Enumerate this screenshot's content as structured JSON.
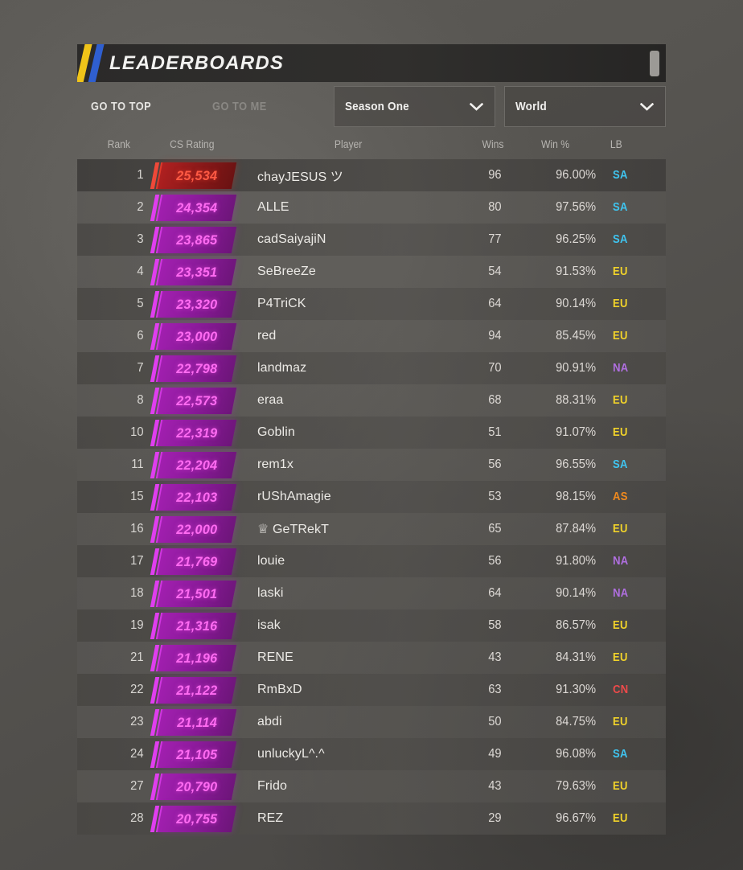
{
  "header": {
    "title": "LEADERBOARDS"
  },
  "toolbar": {
    "go_to_top": "GO TO TOP",
    "go_to_me": "GO TO ME",
    "season_dropdown": {
      "value": "Season One",
      "icon": "chevron-down-icon"
    },
    "region_dropdown": {
      "value": "World",
      "icon": "chevron-down-icon"
    }
  },
  "columns": {
    "rank": "Rank",
    "rating": "CS Rating",
    "player": "Player",
    "wins": "Wins",
    "win_pct": "Win %",
    "lb": "LB"
  },
  "region_colors": {
    "SA": "#3fc4ef",
    "EU": "#f0d22a",
    "NA": "#b06fe0",
    "AS": "#f08a1e",
    "CN": "#ef4a4a"
  },
  "accents": {
    "yellow_bar": "#f0c419",
    "blue_bar": "#2f5fd0",
    "badge_magenta": "#a21fb0",
    "badge_magenta_text": "#ff6bf2",
    "badge_red": "#b02020",
    "badge_red_text": "#ff5a44"
  },
  "rows": [
    {
      "rank": "1",
      "rating": "25,534",
      "player": "chayJESUS ツ",
      "wins": "96",
      "win_pct": "96.00%",
      "lb": "SA",
      "top": true
    },
    {
      "rank": "2",
      "rating": "24,354",
      "player": "ALLE",
      "wins": "80",
      "win_pct": "97.56%",
      "lb": "SA"
    },
    {
      "rank": "3",
      "rating": "23,865",
      "player": "cadSaiyajiN",
      "wins": "77",
      "win_pct": "96.25%",
      "lb": "SA"
    },
    {
      "rank": "4",
      "rating": "23,351",
      "player": "SeBreeZe",
      "wins": "54",
      "win_pct": "91.53%",
      "lb": "EU"
    },
    {
      "rank": "5",
      "rating": "23,320",
      "player": "P4TriCK",
      "wins": "64",
      "win_pct": "90.14%",
      "lb": "EU"
    },
    {
      "rank": "6",
      "rating": "23,000",
      "player": "red",
      "wins": "94",
      "win_pct": "85.45%",
      "lb": "EU"
    },
    {
      "rank": "7",
      "rating": "22,798",
      "player": "landmaz",
      "wins": "70",
      "win_pct": "90.91%",
      "lb": "NA"
    },
    {
      "rank": "8",
      "rating": "22,573",
      "player": "eraa",
      "wins": "68",
      "win_pct": "88.31%",
      "lb": "EU"
    },
    {
      "rank": "10",
      "rating": "22,319",
      "player": "Goblin",
      "wins": "51",
      "win_pct": "91.07%",
      "lb": "EU"
    },
    {
      "rank": "11",
      "rating": "22,204",
      "player": "rem1x",
      "wins": "56",
      "win_pct": "96.55%",
      "lb": "SA"
    },
    {
      "rank": "15",
      "rating": "22,103",
      "player": "rUShAmagie",
      "wins": "53",
      "win_pct": "98.15%",
      "lb": "AS"
    },
    {
      "rank": "16",
      "rating": "22,000",
      "player": "♕ GeTRekT",
      "wins": "65",
      "win_pct": "87.84%",
      "lb": "EU"
    },
    {
      "rank": "17",
      "rating": "21,769",
      "player": "louie",
      "wins": "56",
      "win_pct": "91.80%",
      "lb": "NA"
    },
    {
      "rank": "18",
      "rating": "21,501",
      "player": "laski",
      "wins": "64",
      "win_pct": "90.14%",
      "lb": "NA"
    },
    {
      "rank": "19",
      "rating": "21,316",
      "player": "isak",
      "wins": "58",
      "win_pct": "86.57%",
      "lb": "EU"
    },
    {
      "rank": "21",
      "rating": "21,196",
      "player": "RENE",
      "wins": "43",
      "win_pct": "84.31%",
      "lb": "EU"
    },
    {
      "rank": "22",
      "rating": "21,122",
      "player": "RmBxD",
      "wins": "63",
      "win_pct": "91.30%",
      "lb": "CN"
    },
    {
      "rank": "23",
      "rating": "21,114",
      "player": "abdi",
      "wins": "50",
      "win_pct": "84.75%",
      "lb": "EU"
    },
    {
      "rank": "24",
      "rating": "21,105",
      "player": "unluckyL^.^",
      "wins": "49",
      "win_pct": "96.08%",
      "lb": "SA"
    },
    {
      "rank": "27",
      "rating": "20,790",
      "player": "Frido",
      "wins": "43",
      "win_pct": "79.63%",
      "lb": "EU"
    },
    {
      "rank": "28",
      "rating": "20,755",
      "player": "REZ",
      "wins": "29",
      "win_pct": "96.67%",
      "lb": "EU"
    }
  ]
}
